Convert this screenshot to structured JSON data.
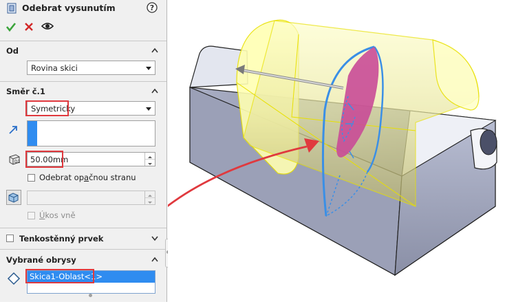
{
  "feature": {
    "title": "Odebrat vysunutím",
    "help_icon": "help-icon",
    "ok_icon": "checkmark-icon",
    "cancel_icon": "close-icon",
    "preview_icon": "eye-icon"
  },
  "od": {
    "title": "Od",
    "value": "Rovina skici"
  },
  "direction": {
    "title": "Směr č.1",
    "end_condition": "Symetricky",
    "depth": "50.00mm",
    "flip_label_prefix": "Odebrat op",
    "flip_label_underline": "a",
    "flip_label_suffix": "čnou stranu",
    "draft_label_prefix": "",
    "draft_label_underline": "Ú",
    "draft_label_suffix": "kos vně"
  },
  "thin": {
    "title": "Tenkostěnný prvek"
  },
  "contours": {
    "title": "Vybrané obrysy",
    "selected": "Skica1-Oblast<1>"
  },
  "colors": {
    "highlight": "#e0393e",
    "selection": "#2f8cf0",
    "preview": "#ffff99",
    "face": "#cc4f9a"
  }
}
